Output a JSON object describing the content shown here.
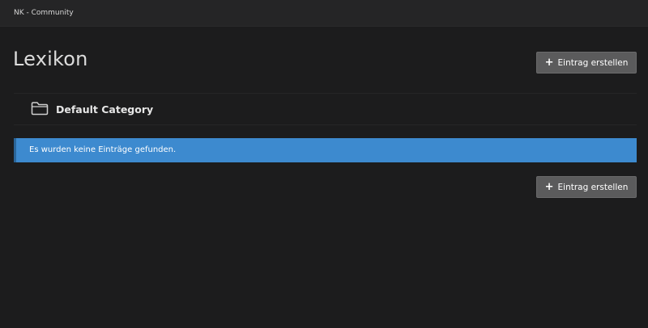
{
  "header": {
    "site_title": "NK - Community"
  },
  "page": {
    "title": "Lexikon"
  },
  "actions": {
    "create_entry_label": "Eintrag erstellen",
    "create_icon": "plus-icon"
  },
  "category": {
    "icon": "folder-icon",
    "name": "Default Category"
  },
  "notice": {
    "message": "Es wurden keine Einträge gefunden.",
    "color": "#3d8acf"
  }
}
